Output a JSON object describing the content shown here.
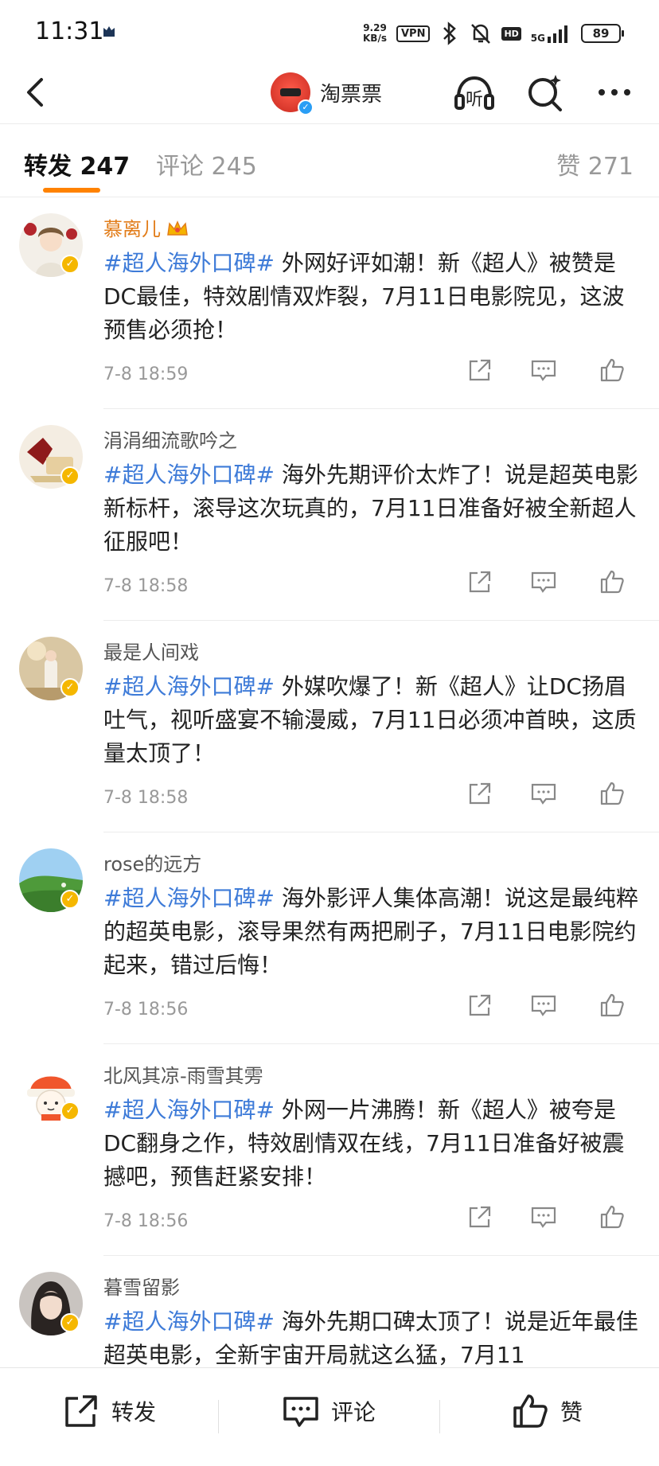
{
  "status_bar": {
    "time": "11:31",
    "speed_value": "9.29",
    "speed_unit": "KB/s",
    "vpn": "VPN",
    "hd": "HD",
    "network": "5G",
    "battery": "89"
  },
  "header": {
    "title": "淘票票",
    "back_icon": "chevron-left-icon",
    "listen_icon": "headphones-listen-icon",
    "search_icon": "search-sparkle-icon",
    "more_icon": "more-dots-icon",
    "listen_label": "听"
  },
  "tabs": {
    "repost_label": "转发 247",
    "comment_label": "评论 245",
    "like_label": "赞 271"
  },
  "colors": {
    "accent": "#ff8200",
    "hashtag": "#3e7bd8",
    "gold_name": "#e27d1a",
    "verified": "#f5b700"
  },
  "posts": [
    {
      "user": "慕离儿",
      "hashtag": "#超人海外口碑#",
      "text": " 外网好评如潮！新《超人》被赞是DC最佳，特效剧情双炸裂，7月11日电影院见，这波预售必须抢！",
      "time": "7-8 18:59"
    },
    {
      "user": "涓涓细流歌吟之",
      "hashtag": "#超人海外口碑#",
      "text": " 海外先期评价太炸了！说是超英电影新标杆，滚导这次玩真的，7月11日准备好被全新超人征服吧！",
      "time": "7-8 18:58"
    },
    {
      "user": "最是人间戏",
      "hashtag": "#超人海外口碑#",
      "text": " 外媒吹爆了！新《超人》让DC扬眉吐气，视听盛宴不输漫威，7月11日必须冲首映，这质量太顶了！",
      "time": "7-8 18:58"
    },
    {
      "user": "rose的远方",
      "hashtag": "#超人海外口碑#",
      "text": " 海外影评人集体高潮！说这是最纯粹的超英电影，滚导果然有两把刷子，7月11日电影院约起来，错过后悔！",
      "time": "7-8 18:56"
    },
    {
      "user": "北风其凉-雨雪其雱",
      "hashtag": "#超人海外口碑#",
      "text": " 外网一片沸腾！新《超人》被夸是DC翻身之作，特效剧情双在线，7月11日准备好被震撼吧，预售赶紧安排！",
      "time": "7-8 18:56"
    },
    {
      "user": "暮雪留影",
      "hashtag": "#超人海外口碑#",
      "text": " 海外先期口碑太顶了！说是近年最佳超英电影，全新宇宙开局就这么猛，7月11",
      "time": ""
    }
  ],
  "bottom_bar": {
    "repost": "转发",
    "comment": "评论",
    "like": "赞"
  }
}
